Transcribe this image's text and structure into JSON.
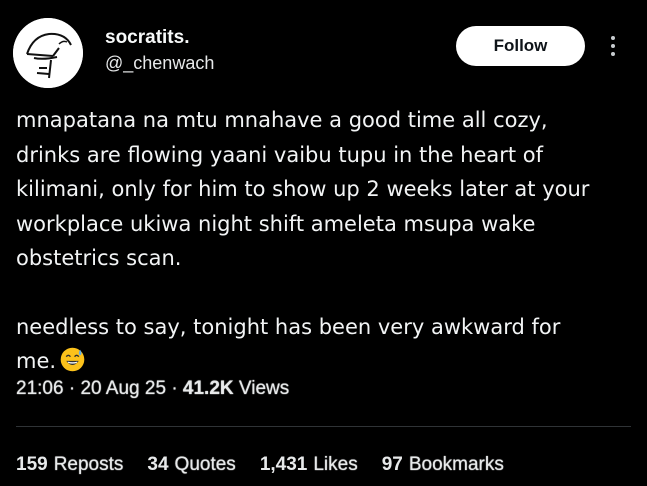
{
  "author": {
    "display_name": "socratits.",
    "handle": "@_chenwach",
    "avatar_icon": "sketch-face-avatar"
  },
  "follow_label": "Follow",
  "more_icon": "vertical-ellipsis-icon",
  "tweet": {
    "paragraph1": "mnapatana na mtu mnahave a good time all cozy,\ndrinks are flowing yaani vaibu tupu in the heart of\nkilimani, only for him to show up 2 weeks later at your\nworkplace ukiwa night shift ameleta msupa wake\nobstetrics scan.",
    "paragraph2": "needless to say, tonight has been very awkward for\nme.",
    "emoji": "grinning-sweat-emoji"
  },
  "meta": {
    "time": "21:06",
    "separator": "·",
    "date": "20 Aug 25",
    "views_count": "41.2K",
    "views_label": "Views"
  },
  "stats": [
    {
      "count": "159",
      "label": "Reposts"
    },
    {
      "count": "34",
      "label": "Quotes"
    },
    {
      "count": "1,431",
      "label": "Likes"
    },
    {
      "count": "97",
      "label": "Bookmarks"
    }
  ],
  "colors": {
    "background": "#000000",
    "text": "#e7e9ea",
    "button_bg": "#ffffff",
    "divider": "#2f3336"
  }
}
